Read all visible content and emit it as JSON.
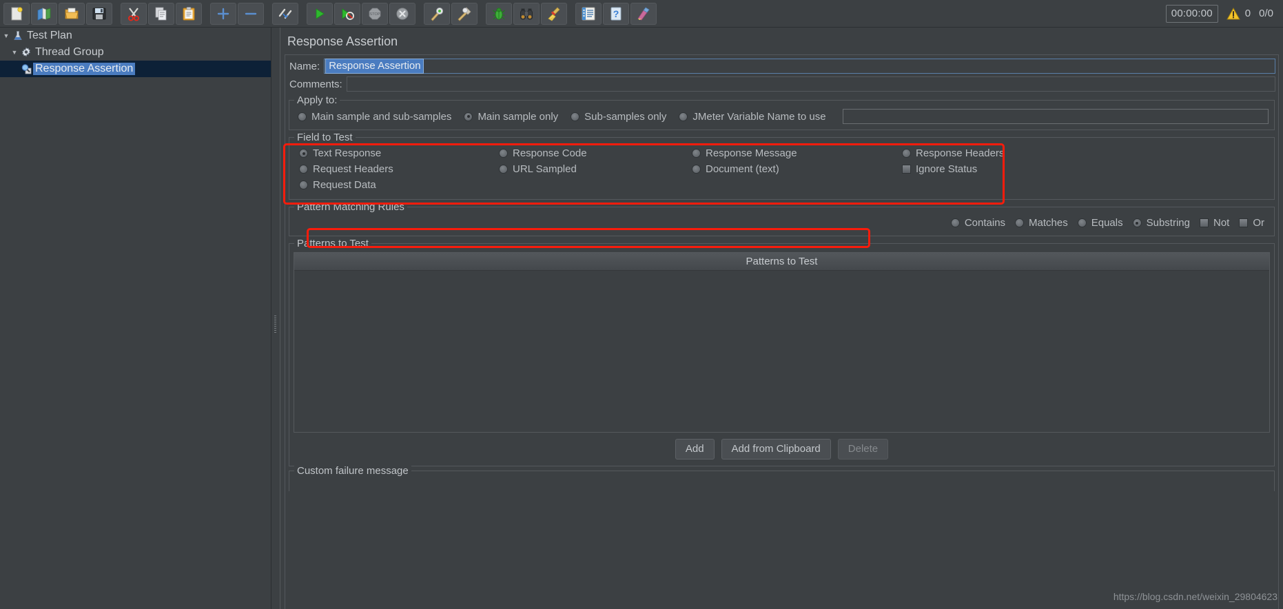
{
  "toolbar": {
    "buttons": [
      {
        "name": "new-icon",
        "glyph": "new"
      },
      {
        "name": "templates-icon",
        "glyph": "templates"
      },
      {
        "name": "open-icon",
        "glyph": "open"
      },
      {
        "name": "save-icon",
        "glyph": "save"
      },
      {
        "name": "cut-icon",
        "glyph": "cut"
      },
      {
        "name": "copy-icon",
        "glyph": "copy"
      },
      {
        "name": "paste-icon",
        "glyph": "paste"
      },
      {
        "name": "expand-all-icon",
        "glyph": "plus"
      },
      {
        "name": "collapse-all-icon",
        "glyph": "minus"
      },
      {
        "name": "toggle-icon",
        "glyph": "toggle"
      },
      {
        "name": "start-icon",
        "glyph": "start"
      },
      {
        "name": "start-no-pauses-icon",
        "glyph": "start-no-pause"
      },
      {
        "name": "stop-icon",
        "glyph": "stop"
      },
      {
        "name": "shutdown-icon",
        "glyph": "shutdown"
      },
      {
        "name": "clear-icon",
        "glyph": "clear"
      },
      {
        "name": "clear-all-icon",
        "glyph": "clear-all"
      },
      {
        "name": "function-helper-icon",
        "glyph": "bug"
      },
      {
        "name": "search-icon",
        "glyph": "binoculars"
      },
      {
        "name": "reset-search-icon",
        "glyph": "broom"
      },
      {
        "name": "log-viewer-icon",
        "glyph": "log"
      },
      {
        "name": "help-icon",
        "glyph": "help"
      },
      {
        "name": "undo-icon",
        "glyph": "undo"
      }
    ],
    "timer": "00:00:00",
    "warning_count": "0",
    "thread_counter": "0/0"
  },
  "tree": {
    "items": [
      {
        "label": "Test Plan",
        "icon": "test-plan-icon",
        "indent": 0,
        "expanded": true,
        "selected": false
      },
      {
        "label": "Thread Group",
        "icon": "thread-group-icon",
        "indent": 1,
        "expanded": true,
        "selected": false
      },
      {
        "label": "Response Assertion",
        "icon": "response-assertion-icon",
        "indent": 2,
        "expanded": null,
        "selected": true
      }
    ]
  },
  "panel": {
    "title": "Response Assertion",
    "name_label": "Name:",
    "name_value": "Response Assertion",
    "comments_label": "Comments:",
    "comments_value": "",
    "apply_to": {
      "title": "Apply to:",
      "options": [
        {
          "label": "Main sample and sub-samples",
          "selected": false
        },
        {
          "label": "Main sample only",
          "selected": true
        },
        {
          "label": "Sub-samples only",
          "selected": false
        },
        {
          "label": "JMeter Variable Name to use",
          "selected": false
        }
      ],
      "variable_value": ""
    },
    "field_to_test": {
      "title": "Field to Test",
      "options": [
        {
          "label": "Text Response",
          "type": "radio",
          "selected": true
        },
        {
          "label": "Response Code",
          "type": "radio",
          "selected": false
        },
        {
          "label": "Response Message",
          "type": "radio",
          "selected": false
        },
        {
          "label": "Response Headers",
          "type": "radio",
          "selected": false
        },
        {
          "label": "Request Headers",
          "type": "radio",
          "selected": false
        },
        {
          "label": "URL Sampled",
          "type": "radio",
          "selected": false
        },
        {
          "label": "Document (text)",
          "type": "radio",
          "selected": false
        },
        {
          "label": "Ignore Status",
          "type": "checkbox",
          "selected": false
        },
        {
          "label": "Request Data",
          "type": "radio",
          "selected": false
        }
      ]
    },
    "pattern_matching_rules": {
      "title": "Pattern Matching Rules",
      "options": [
        {
          "label": "Contains",
          "type": "radio",
          "selected": false
        },
        {
          "label": "Matches",
          "type": "radio",
          "selected": false
        },
        {
          "label": "Equals",
          "type": "radio",
          "selected": false
        },
        {
          "label": "Substring",
          "type": "radio",
          "selected": true
        },
        {
          "label": "Not",
          "type": "checkbox",
          "selected": false
        },
        {
          "label": "Or",
          "type": "checkbox",
          "selected": false
        }
      ]
    },
    "patterns_to_test": {
      "title": "Patterns to Test",
      "column_header": "Patterns to Test",
      "rows": [],
      "buttons": [
        {
          "label": "Add",
          "disabled": false
        },
        {
          "label": "Add from Clipboard",
          "disabled": false
        },
        {
          "label": "Delete",
          "disabled": true
        }
      ]
    },
    "custom_failure_message": {
      "title": "Custom failure message"
    }
  },
  "watermark": "https://blog.csdn.net/weixin_29804623",
  "colors": {
    "annotation_red": "#f91c0c",
    "selection_blue": "#4a7cc0",
    "tree_selection_bg": "#0d2137",
    "panel_bg": "#3c4043"
  }
}
